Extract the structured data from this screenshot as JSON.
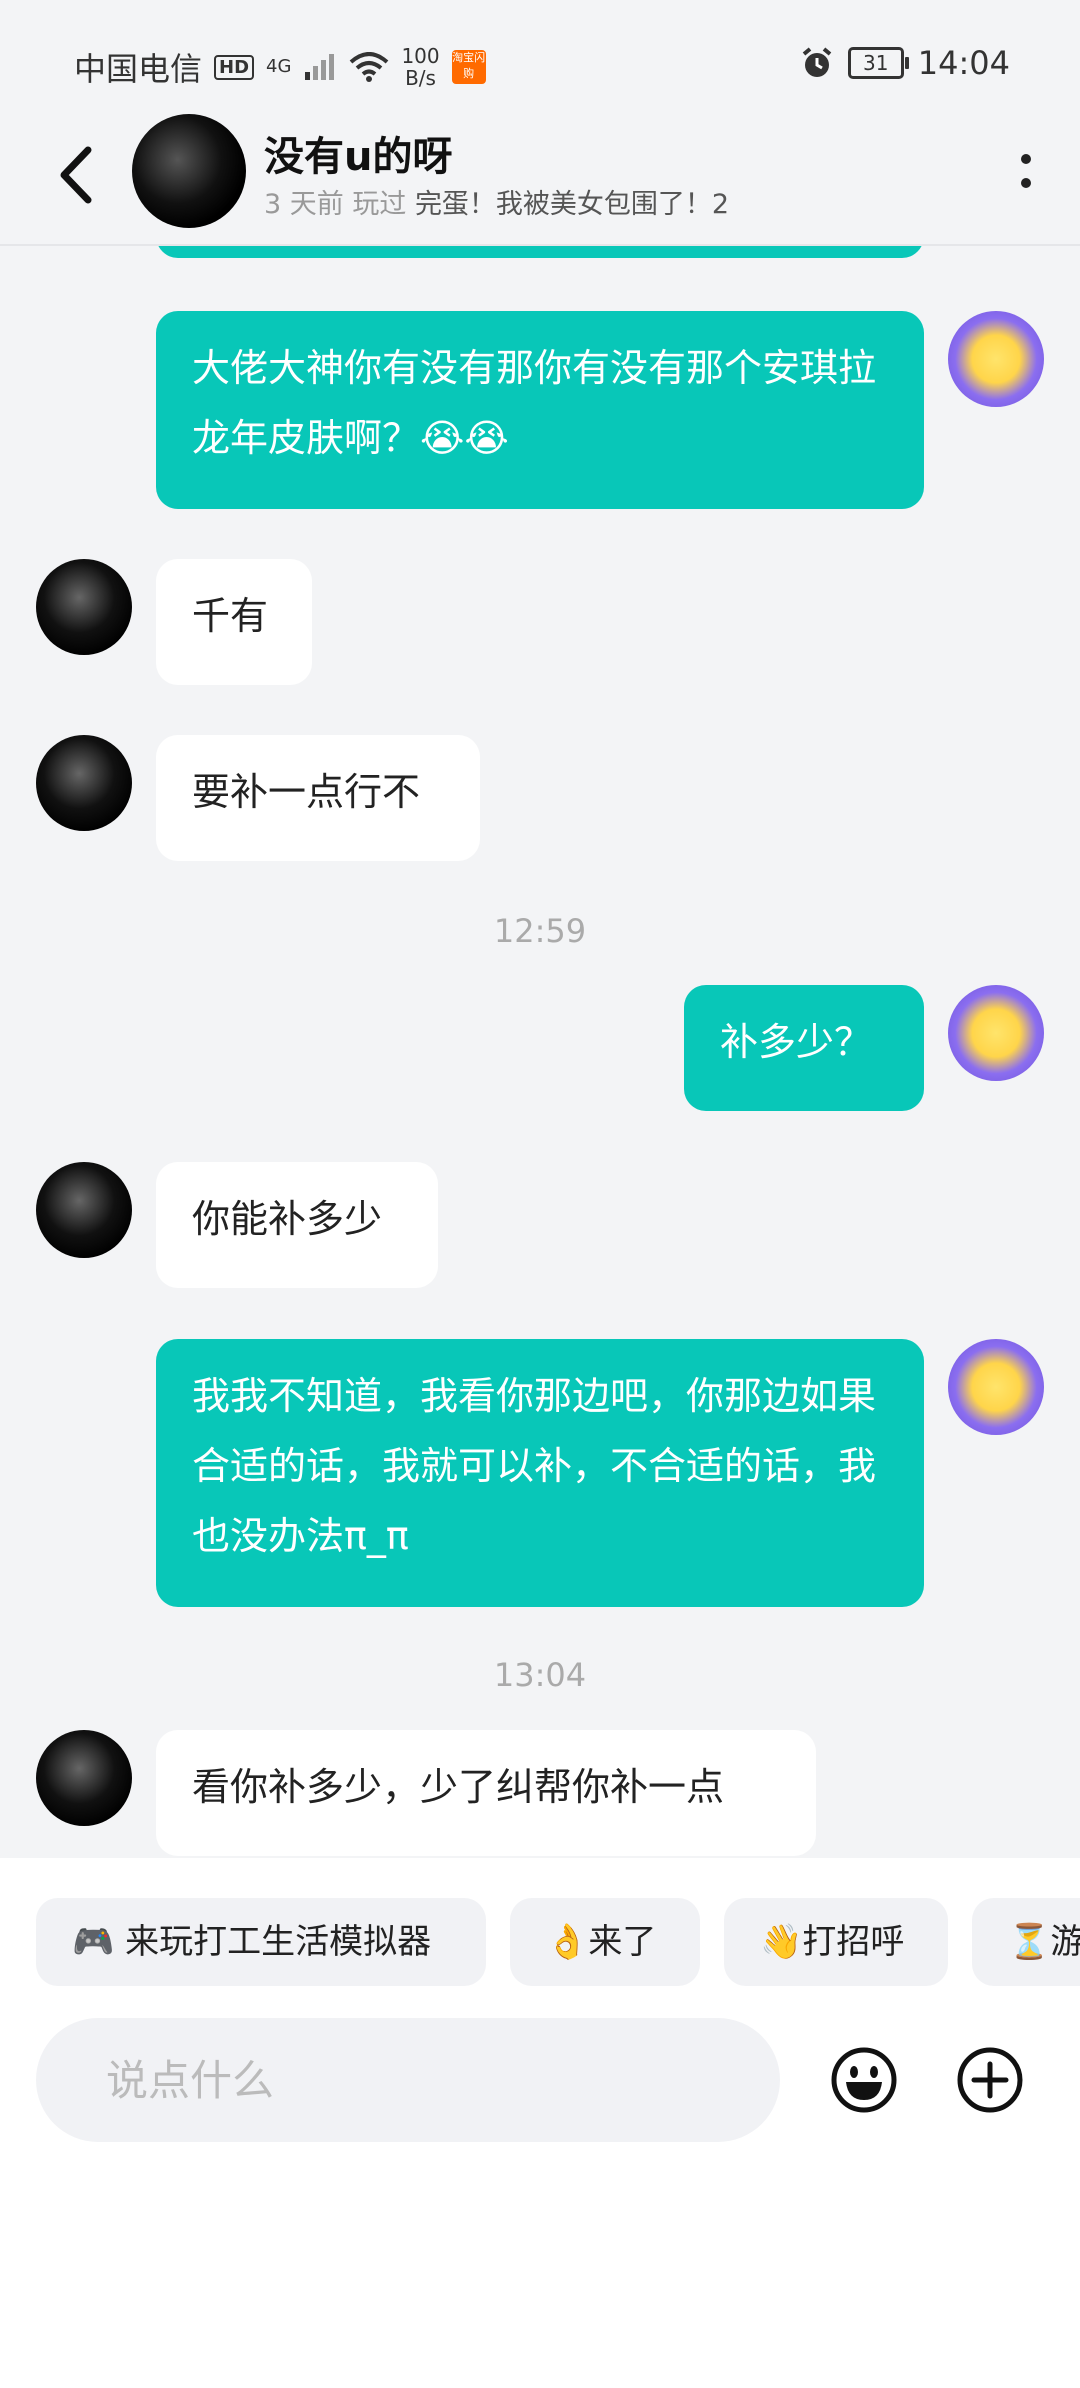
{
  "status_bar": {
    "carrier": "中国电信",
    "hd": "HD",
    "network": "4G",
    "speed_value": "100",
    "speed_unit": "B/s",
    "taobao_badge": "淘宝闪购",
    "battery": "31",
    "time": "14:04"
  },
  "header": {
    "name": "没有u的呀",
    "played_time": "3 天前 玩过",
    "game": "完蛋！我被美女包围了！2"
  },
  "messages": [
    {
      "side": "me",
      "text": "大佬大神你有没有那你有没有那个安琪拉龙年皮肤啊？😭😭"
    },
    {
      "side": "other",
      "text": "千有"
    },
    {
      "side": "other",
      "text": "要补一点行不"
    },
    {
      "time": "12:59"
    },
    {
      "side": "me",
      "text": "补多少？"
    },
    {
      "side": "other",
      "text": "你能补多少"
    },
    {
      "side": "me",
      "text": "我我不知道，我看你那边吧，你那边如果合适的话，我就可以补，不合适的话，我也没办法π_π"
    },
    {
      "time": "13:04"
    },
    {
      "side": "other",
      "text": "看你补多少，少了纠帮你补一点"
    }
  ],
  "quick_replies": [
    "🎮 来玩打工生活模拟器",
    "👌来了",
    "👋打招呼",
    "⏳游"
  ],
  "input": {
    "placeholder": "说点什么"
  },
  "icons": {
    "emoji": "emoji-icon",
    "add": "plus-circle-icon",
    "back": "back-arrow-icon",
    "more": "more-vertical-icon"
  },
  "colors": {
    "accent": "#08c7b8",
    "background": "#f3f4f6"
  }
}
